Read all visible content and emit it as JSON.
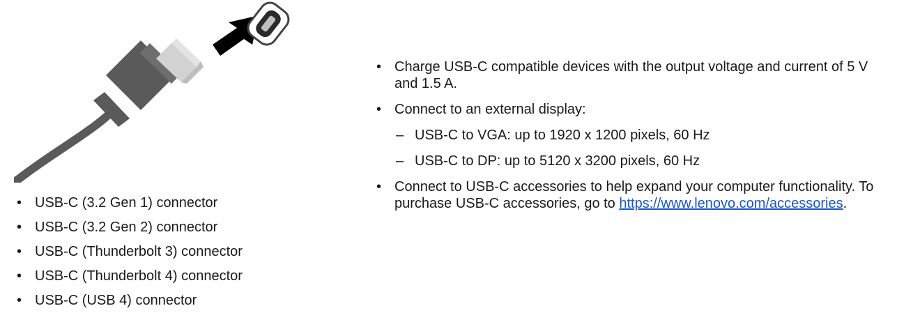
{
  "illustration": {
    "icon": "usb-c-cable-plugging-into-port",
    "colors": {
      "cable": "#5a5a5a",
      "connector": "#dcdcdc",
      "arrow": "#000000"
    }
  },
  "connectors": [
    "USB-C (3.2 Gen 1) connector",
    "USB-C (3.2 Gen 2) connector",
    "USB-C (Thunderbolt 3) connector",
    "USB-C (Thunderbolt 4) connector",
    "USB-C (USB 4) connector"
  ],
  "features": {
    "charge": "Charge USB-C compatible devices with the output voltage and current of 5 V and 1.5 A.",
    "display": "Connect to an external display:",
    "display_options": [
      "USB-C to VGA: up to 1920 x 1200 pixels, 60 Hz",
      "USB-C to DP: up to 5120 x 3200 pixels, 60 Hz"
    ],
    "accessories_text": "Connect to USB-C accessories to help expand your computer functionality. To purchase USB-C accessories, go to ",
    "accessories_link": "https://​www.lenovo.com/accessories",
    "accessories_end": "."
  },
  "bullet_char": "•",
  "dash_char": "–"
}
